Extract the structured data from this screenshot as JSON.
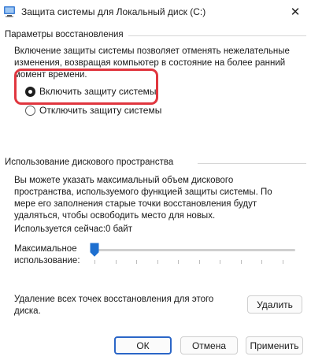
{
  "window": {
    "title": "Защита системы для Локальный диск (C:)",
    "close_glyph": "✕"
  },
  "restore_settings": {
    "header": "Параметры восстановления",
    "description": "Включение защиты системы позволяет отменять нежелательные изменения, возвращая компьютер в состояние на более ранний момент времени.",
    "options": [
      {
        "label": "Включить защиту системы",
        "selected": true
      },
      {
        "label": "Отключить защиту системы",
        "selected": false
      }
    ]
  },
  "disk_usage": {
    "header": "Использование дискового пространства",
    "description": "Вы можете указать максимальный объем дискового пространства, используемого функцией защиты системы. По мере его заполнения старые точки восстановления будут удаляться, чтобы освободить место для новых.",
    "current_usage_label": "Используется сейчас:",
    "current_usage_value": "0 байт",
    "max_usage_label_line1": "Максимальное",
    "max_usage_label_line2": "использование:",
    "max_usage_fraction": 0.0,
    "delete_text_line1": "Удаление всех точек восстановления для этого",
    "delete_text_line2": "диска.",
    "delete_button": "Удалить"
  },
  "footer": {
    "ok": "ОК",
    "cancel": "Отмена",
    "apply": "Применить"
  },
  "colors": {
    "accent": "#2b66c7",
    "highlight": "#e0363f",
    "slider_thumb": "#1e6fd0"
  }
}
